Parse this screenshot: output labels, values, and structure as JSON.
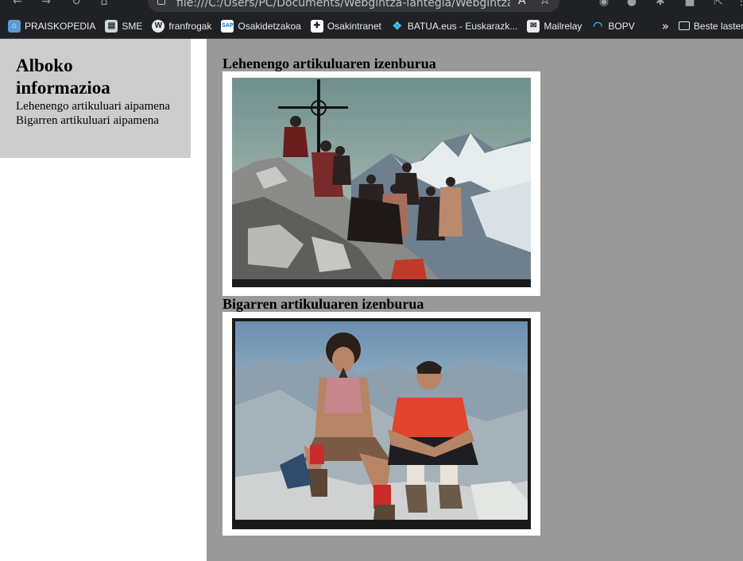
{
  "browser": {
    "url": "file:///C:/Users/PC/Documents/Webgintza-lantegia/Webgintza-lantegia",
    "bookmarks": [
      {
        "label": "PRAISKOPEDIA",
        "icon": "praiskopedia-icon",
        "color": "#5b9bd5"
      },
      {
        "label": "SME",
        "icon": "sme-icon",
        "color": "#cfd8dc"
      },
      {
        "label": "franfrogak",
        "icon": "wordpress-icon",
        "color": "#e8eaed"
      },
      {
        "label": "Osakidetzakoa",
        "icon": "sap-icon",
        "color": "#ffffff"
      },
      {
        "label": "Osakintranet",
        "icon": "osakintranet-icon",
        "color": "#ffffff"
      },
      {
        "label": "BATUA.eus - Euskarazk...",
        "icon": "batua-icon",
        "color": "#4fc3f7"
      },
      {
        "label": "Mailrelay",
        "icon": "mail-icon",
        "color": "#e8eaed"
      },
      {
        "label": "BOPV",
        "icon": "bopv-icon",
        "color": "#29b6f6"
      }
    ],
    "more_label": "»",
    "other_bookmarks_label": "Beste laster-marka"
  },
  "sidebar": {
    "title": "Alboko informazioa",
    "items": [
      {
        "label": "Lehenengo artikuluari aipamena"
      },
      {
        "label": "Bigarren artikuluari aipamena"
      }
    ]
  },
  "articles": [
    {
      "title": "Lehenengo artikuluaren izenburua",
      "image": "mountain-summit-group-photo"
    },
    {
      "title": "Bigarren artikuluaren izenburua",
      "image": "two-climbers-summit-photo"
    }
  ],
  "colors": {
    "sidebar_bg": "#cccccc",
    "main_bg": "#999999",
    "chrome_bg": "#202124"
  }
}
